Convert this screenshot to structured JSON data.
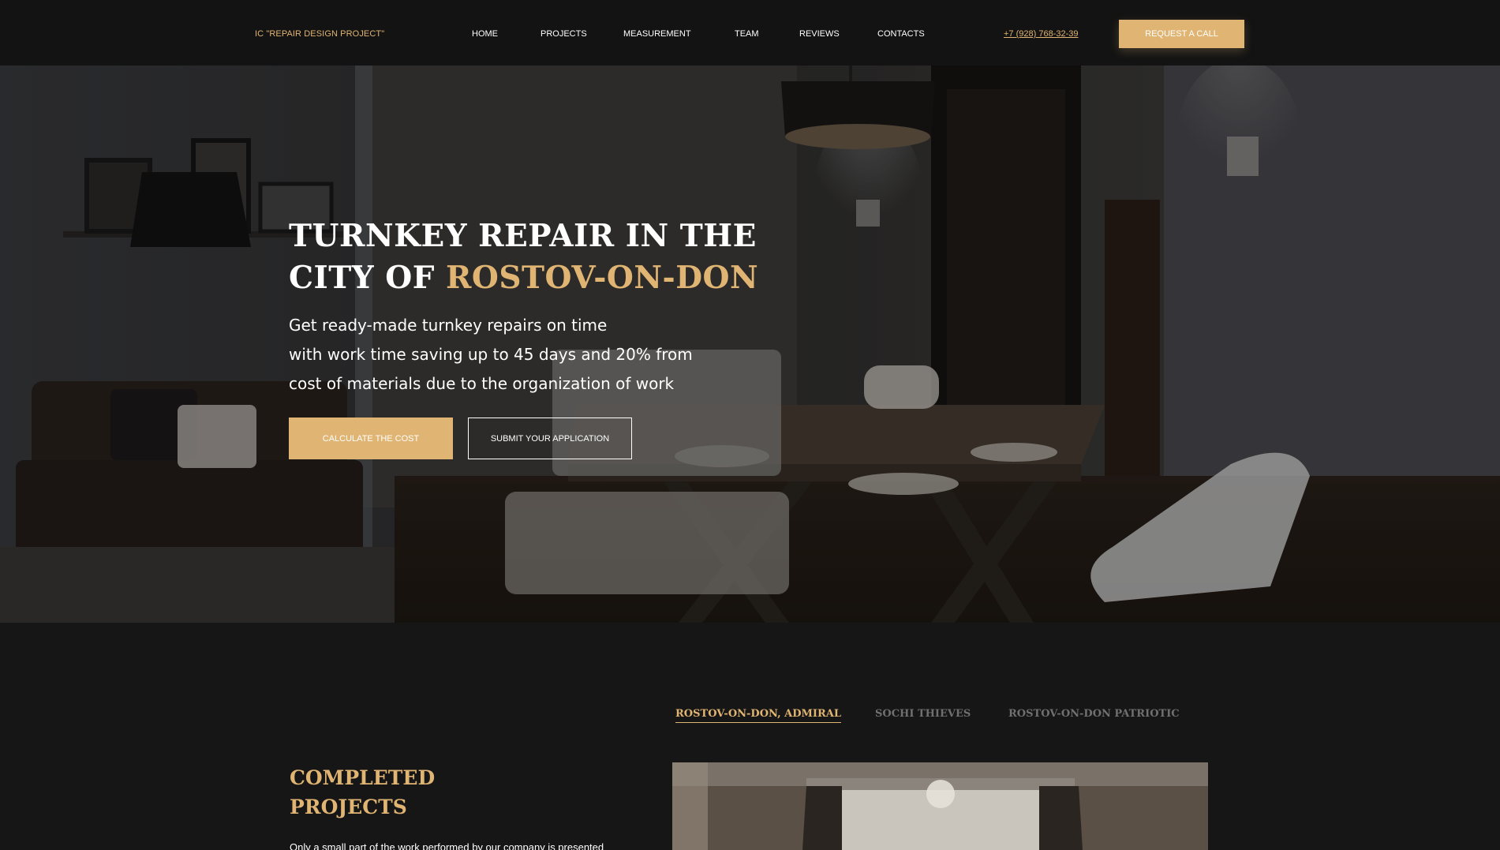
{
  "header": {
    "logo": "IC \"REPAIR DESIGN PROJECT\"",
    "nav": [
      "HOME",
      "PROJECTS",
      "MEASUREMENT",
      "TEAM",
      "REVIEWS",
      "CONTACTS"
    ],
    "phone": "+7 (928) 768-32-39",
    "cta_label": "REQUEST A CALL"
  },
  "hero": {
    "title_line1": "TURNKEY REPAIR IN THE",
    "title_line2_prefix": "CITY OF ",
    "title_accent": "ROSTOV-ON-DON",
    "subtitle_lines": [
      "Get ready-made turnkey repairs on time",
      "with work time saving up to 45 days and 20% from",
      "cost of materials due to the organization of work"
    ],
    "btn_calc_label": "CALCULATE THE COST",
    "btn_submit_label": "SUBMIT YOUR APPLICATION"
  },
  "projects": {
    "tabs": [
      "ROSTOV-ON-DON, ADMIRAL",
      "SOCHI THIEVES",
      "ROSTOV-ON-DON PATRIOTIC"
    ],
    "active_tab": 0,
    "title_line1": "COMPLETED",
    "title_line2": "PROJECTS",
    "text": "Only a small part of the work performed by our company is presented"
  },
  "colors": {
    "accent": "#e0b472",
    "header_bg": "#131313",
    "page_bg": "#161616",
    "inactive_tab": "#707070"
  }
}
